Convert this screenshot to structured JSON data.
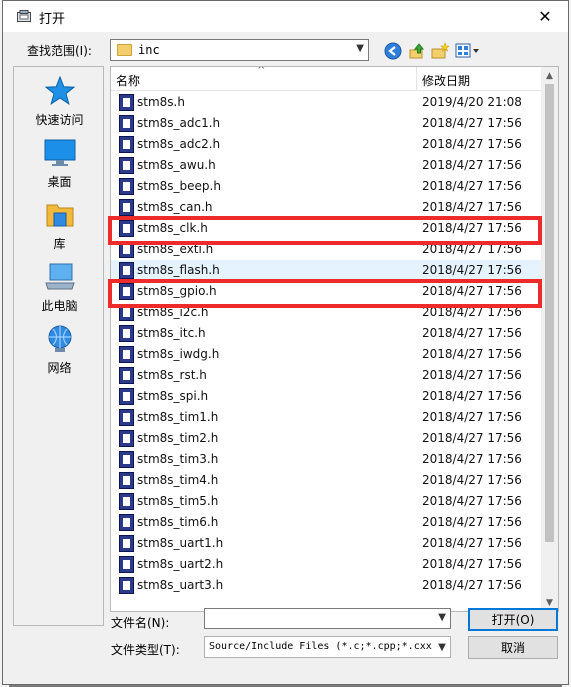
{
  "window": {
    "title": "打开",
    "close_glyph": "✕"
  },
  "lookin": {
    "label": "查找范围(I):",
    "value": "inc"
  },
  "places": [
    {
      "label": "快速访问",
      "icon": "quick-access-star-icon"
    },
    {
      "label": "桌面",
      "icon": "desktop-icon"
    },
    {
      "label": "库",
      "icon": "library-icon"
    },
    {
      "label": "此电脑",
      "icon": "this-pc-icon"
    },
    {
      "label": "网络",
      "icon": "network-icon"
    }
  ],
  "columns": {
    "name": "名称",
    "date": "修改日期"
  },
  "files": [
    {
      "name": "stm8s.h",
      "date": "2019/4/20 21:08"
    },
    {
      "name": "stm8s_adc1.h",
      "date": "2018/4/27 17:56"
    },
    {
      "name": "stm8s_adc2.h",
      "date": "2018/4/27 17:56"
    },
    {
      "name": "stm8s_awu.h",
      "date": "2018/4/27 17:56"
    },
    {
      "name": "stm8s_beep.h",
      "date": "2018/4/27 17:56"
    },
    {
      "name": "stm8s_can.h",
      "date": "2018/4/27 17:56"
    },
    {
      "name": "stm8s_clk.h",
      "date": "2018/4/27 17:56"
    },
    {
      "name": "stm8s_exti.h",
      "date": "2018/4/27 17:56"
    },
    {
      "name": "stm8s_flash.h",
      "date": "2018/4/27 17:56"
    },
    {
      "name": "stm8s_gpio.h",
      "date": "2018/4/27 17:56"
    },
    {
      "name": "stm8s_i2c.h",
      "date": "2018/4/27 17:56"
    },
    {
      "name": "stm8s_itc.h",
      "date": "2018/4/27 17:56"
    },
    {
      "name": "stm8s_iwdg.h",
      "date": "2018/4/27 17:56"
    },
    {
      "name": "stm8s_rst.h",
      "date": "2018/4/27 17:56"
    },
    {
      "name": "stm8s_spi.h",
      "date": "2018/4/27 17:56"
    },
    {
      "name": "stm8s_tim1.h",
      "date": "2018/4/27 17:56"
    },
    {
      "name": "stm8s_tim2.h",
      "date": "2018/4/27 17:56"
    },
    {
      "name": "stm8s_tim3.h",
      "date": "2018/4/27 17:56"
    },
    {
      "name": "stm8s_tim4.h",
      "date": "2018/4/27 17:56"
    },
    {
      "name": "stm8s_tim5.h",
      "date": "2018/4/27 17:56"
    },
    {
      "name": "stm8s_tim6.h",
      "date": "2018/4/27 17:56"
    },
    {
      "name": "stm8s_uart1.h",
      "date": "2018/4/27 17:56"
    },
    {
      "name": "stm8s_uart2.h",
      "date": "2018/4/27 17:56"
    },
    {
      "name": "stm8s_uart3.h",
      "date": "2018/4/27 17:56"
    }
  ],
  "hover_row": "stm8s_flash.h",
  "marked_rows": [
    "stm8s_clk.h",
    "stm8s_gpio.h"
  ],
  "marker_color": "#ee2b2b",
  "filename": {
    "label": "文件名(N):",
    "value": ""
  },
  "filetype": {
    "label": "文件类型(T):",
    "value": "Source/Include Files (*.c;*.cpp;*.cxx"
  },
  "buttons": {
    "open": "打开(O)",
    "cancel": "取消"
  }
}
